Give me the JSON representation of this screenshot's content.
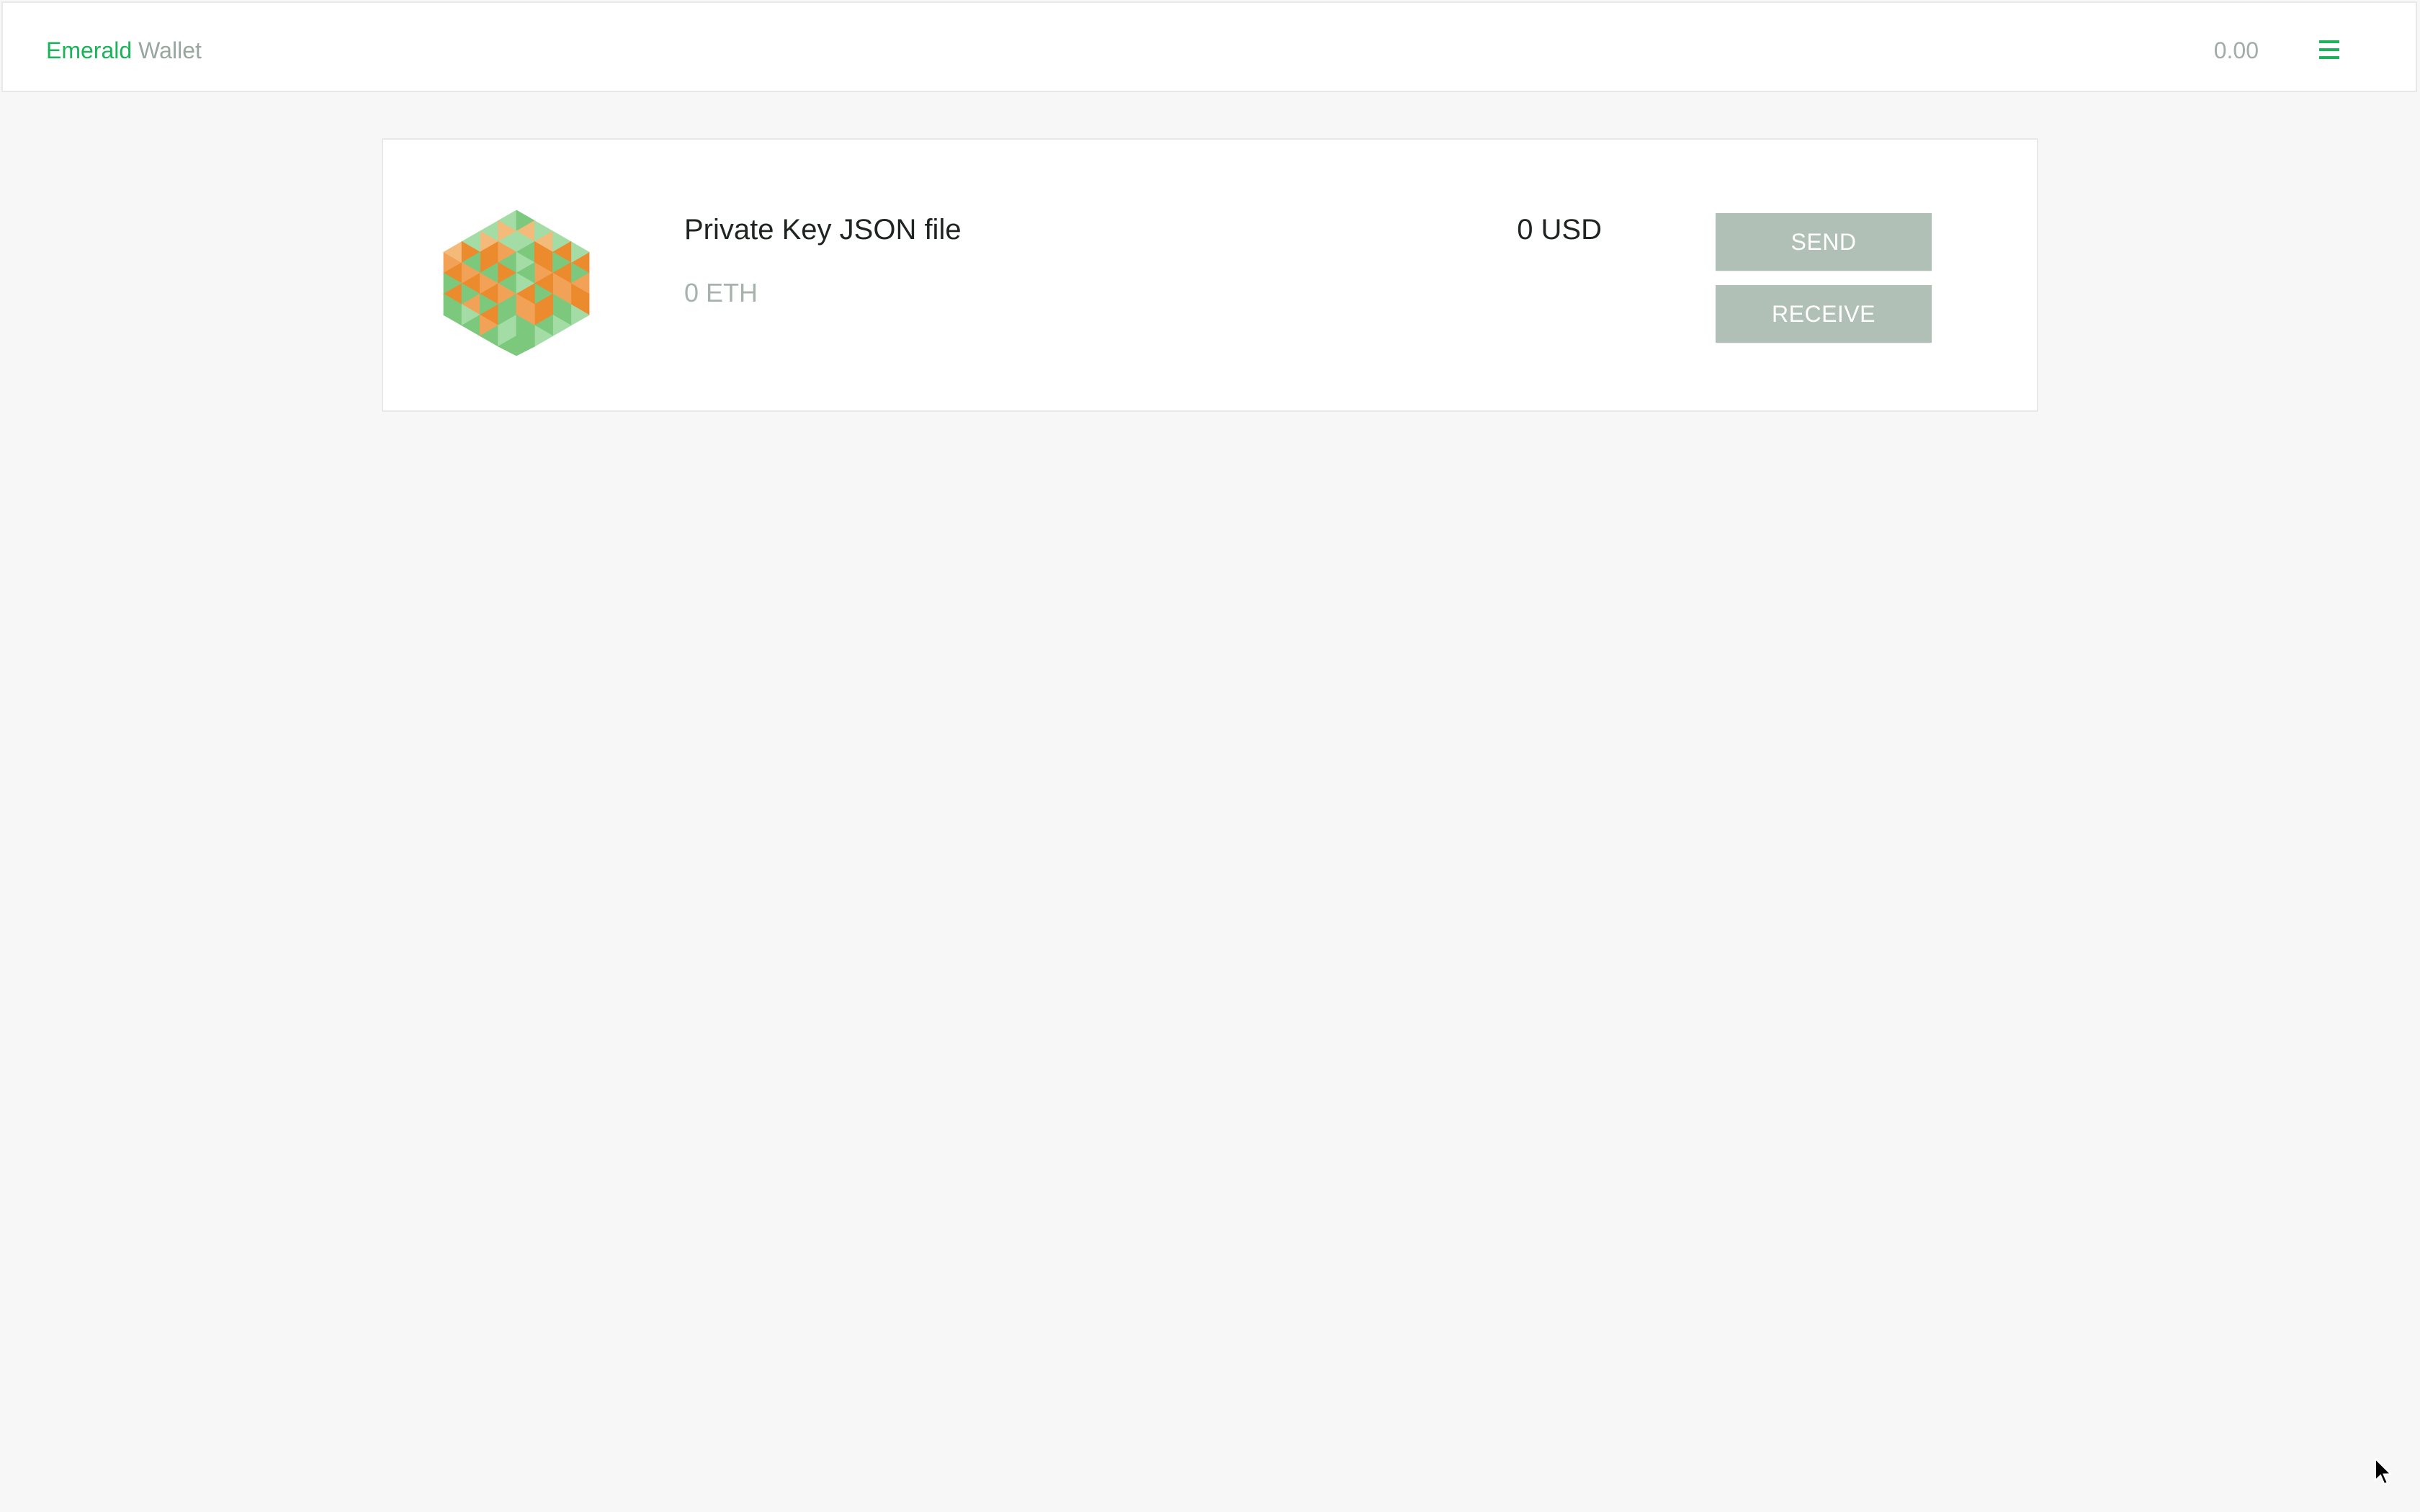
{
  "app": {
    "brand_primary": "Emerald",
    "brand_secondary": "Wallet",
    "total_balance": "0.00",
    "menu_icon": "hamburger-menu-icon"
  },
  "account": {
    "name": "Private Key JSON file",
    "balance_eth": "0 ETH",
    "balance_fiat": "0 USD",
    "avatar_icon": "identicon-avatar",
    "send_label": "SEND",
    "receive_label": "RECEIVE"
  },
  "colors": {
    "brand_green": "#1bb35a",
    "muted_text": "#98a6a0",
    "button_bg": "#b0c0b6",
    "background": "#f6f7f6",
    "identicon_orange": "#ec8b2e",
    "identicon_green": "#7cc97e",
    "identicon_light_green": "#a4dca6",
    "identicon_peach": "#f3ba7a"
  }
}
